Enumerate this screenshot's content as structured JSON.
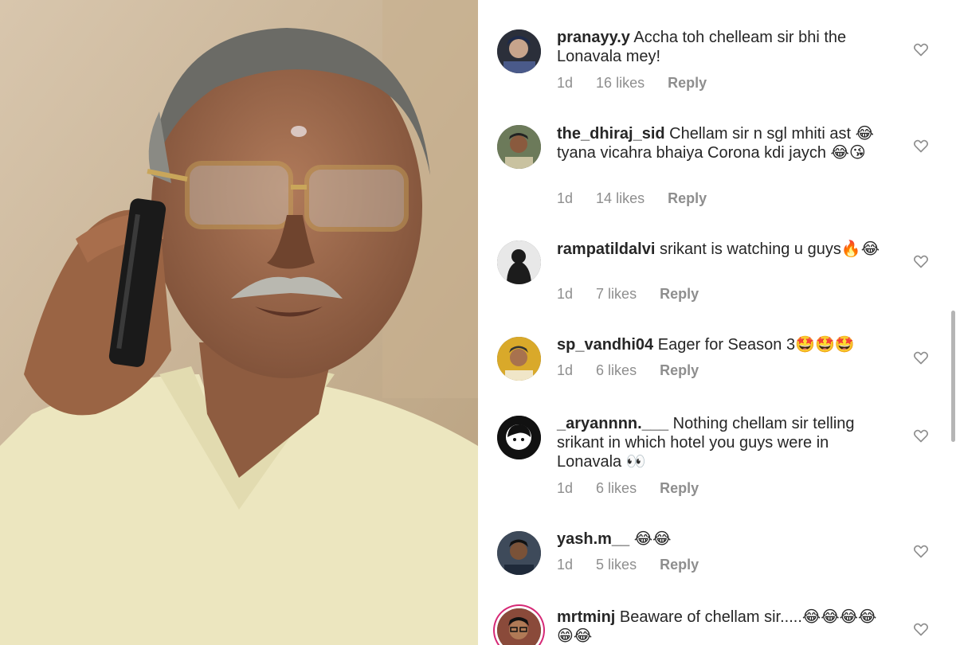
{
  "photo": {
    "description_icon": "man-on-phone-photo"
  },
  "comments": [
    {
      "username": "pranayy.y",
      "text": "Accha toh chelleam sir bhi the Lonavala mey!",
      "time": "1d",
      "likes": "16 likes",
      "reply": "Reply",
      "avatar_color": "#2b2f3a"
    },
    {
      "username": "the_dhiraj_sid",
      "text": "Chellam sir n sgl mhiti ast 😂 tyana vicahra bhaiya Corona kdi jaych 😂😘",
      "time": "1d",
      "likes": "14 likes",
      "reply": "Reply",
      "avatar_color": "#6c7a5a"
    },
    {
      "username": "rampatildalvi",
      "text": "srikant is watching u guys🔥😂",
      "time": "1d",
      "likes": "7 likes",
      "reply": "Reply",
      "avatar_color": "#1c1c1c"
    },
    {
      "username": "sp_vandhi04",
      "text": "Eager for Season 3🤩🤩🤩",
      "time": "1d",
      "likes": "6 likes",
      "reply": "Reply",
      "avatar_color": "#d9a92a"
    },
    {
      "username": "_aryannnn.___",
      "text": "Nothing chellam sir telling srikant in which hotel you guys were in Lonavala 👀",
      "time": "1d",
      "likes": "6 likes",
      "reply": "Reply",
      "avatar_color": "#111111"
    },
    {
      "username": "yash.m__",
      "text": "😂😂",
      "time": "1d",
      "likes": "5 likes",
      "reply": "Reply",
      "avatar_color": "#3e4a5a"
    },
    {
      "username": "mrtminj",
      "text": "Beaware of chellam sir.....😂😂😂😂😁😂",
      "time": "",
      "likes": "",
      "reply": "",
      "avatar_color": "#8a4a3a"
    }
  ],
  "icons": {
    "like": "heart-outline-icon"
  }
}
